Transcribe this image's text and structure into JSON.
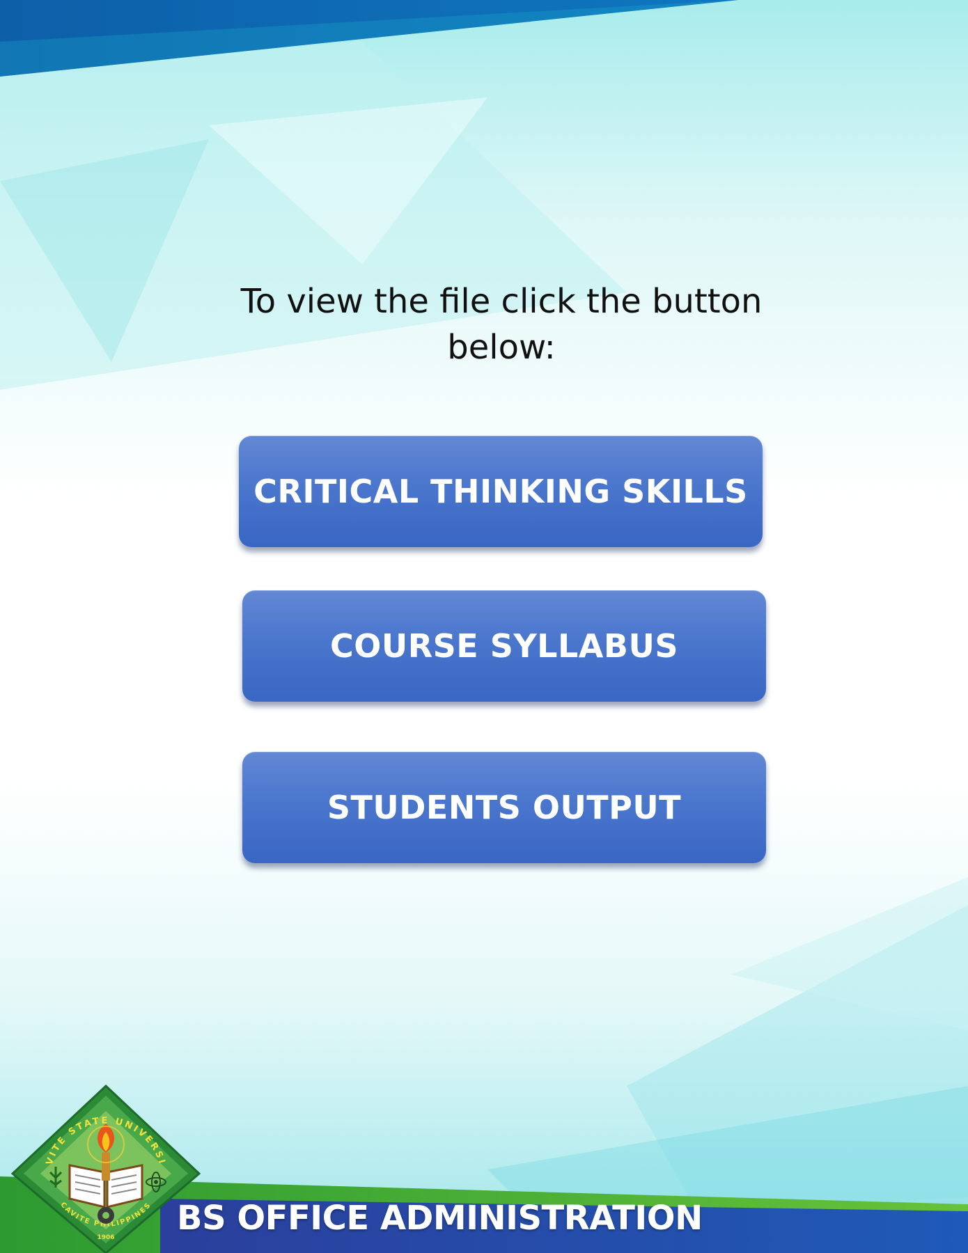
{
  "instruction": {
    "line1": "To view the file click the button",
    "line2": "below:"
  },
  "buttons": [
    {
      "label": "CRITICAL THINKING SKILLS"
    },
    {
      "label": "COURSE SYLLABUS"
    },
    {
      "label": "STUDENTS OUTPUT"
    }
  ],
  "footer": {
    "program": "BS OFFICE ADMINISTRATION"
  },
  "logo": {
    "icon": "university-seal-icon",
    "top_text": "CAVITE STATE UNIVERSITY",
    "bottom_text": "CAVITE PHILIPPINES",
    "year": "1906"
  },
  "colors": {
    "button": "#4a76cd",
    "top_band": "#0a67b0",
    "bottom_band": "#1f3f9a",
    "green": "#2e9b2e"
  }
}
